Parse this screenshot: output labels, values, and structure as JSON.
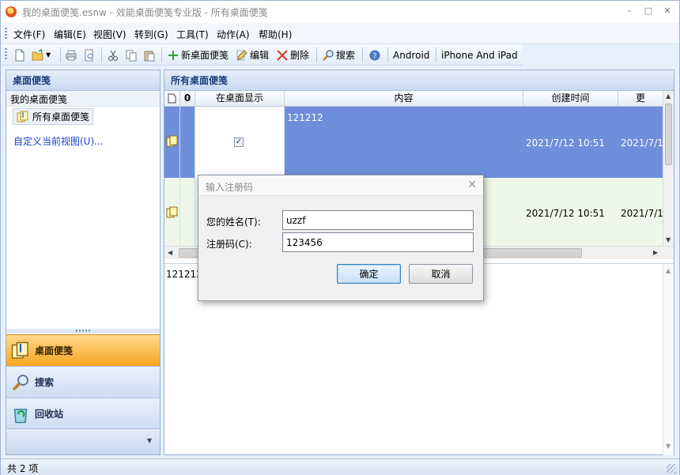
{
  "window": {
    "title": "我的桌面便笺.esnw - 效能桌面便笺专业版 - 所有桌面便笺",
    "min_label": "–",
    "max_label": "□",
    "close_label": "✕"
  },
  "menu": [
    "文件(F)",
    "编辑(E)",
    "视图(V)",
    "转到(G)",
    "工具(T)",
    "动作(A)",
    "帮助(H)"
  ],
  "toolbar": {
    "new_note": "新桌面便笺",
    "edit": "编辑",
    "delete": "删除",
    "search": "搜索",
    "android": "Android",
    "iphone": "iPhone And iPad"
  },
  "left_panel": {
    "header": "桌面便笺",
    "group": "我的桌面便笺",
    "selected_folder": "所有桌面便笺",
    "custom_view_link": "自定义当前视图(U)...",
    "nav": [
      {
        "label": "桌面便笺",
        "icon": "note-icon",
        "active": true
      },
      {
        "label": "搜索",
        "icon": "search-icon",
        "active": false
      },
      {
        "label": "回收站",
        "icon": "recycle-bin-icon",
        "active": false
      }
    ]
  },
  "right_panel": {
    "header": "所有桌面便笺",
    "columns": [
      "",
      "",
      "在桌面显示",
      "内容",
      "创建时间",
      "更"
    ],
    "rows": [
      {
        "content": "121212",
        "show_on_desktop": true,
        "created": "2021/7/12 10:51",
        "modified": "2021/7/1",
        "selected": true
      },
      {
        "content": "",
        "show_on_desktop": false,
        "created": "2021/7/12 10:51",
        "modified": "2021/7/1",
        "selected": false
      }
    ],
    "preview_text": "121212"
  },
  "status": {
    "count_text": "共 2 项"
  },
  "dialog": {
    "title": "输入注册码",
    "close_label": "✕",
    "name_label": "您的姓名(T):",
    "name_value": "uzzf",
    "code_label": "注册码(C):",
    "code_value": "123456",
    "ok_label": "确定",
    "cancel_label": "取消"
  },
  "colors": {
    "selected_row": "#6f8fdb",
    "second_row": "#eef7ea",
    "active_nav": "#f5a623",
    "panel_header_text": "#1d3e7a",
    "link": "#1a3ecf"
  }
}
